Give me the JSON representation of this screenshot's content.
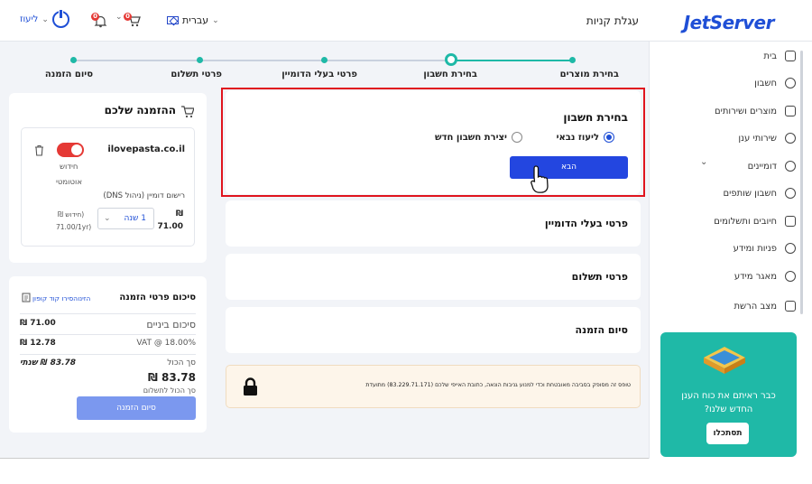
{
  "header": {
    "logo": "JetServer",
    "page_title": "עגלת קניות",
    "language": "עברית",
    "user": "ליעוז",
    "cart_count": "0",
    "notif_count": "0"
  },
  "sidebar": {
    "items": [
      {
        "label": "בית",
        "icon": "home-icon"
      },
      {
        "label": "חשבון",
        "icon": "user-icon"
      },
      {
        "label": "מוצרים ושירותים",
        "icon": "box-icon"
      },
      {
        "label": "שירותי ענן",
        "icon": "cloud-icon"
      },
      {
        "label": "דומיינים",
        "icon": "globe-icon"
      },
      {
        "label": "חשבון שותפים",
        "icon": "users-icon"
      },
      {
        "label": "חיובים ותשלומים",
        "icon": "invoice-icon"
      },
      {
        "label": "פניות ומידע",
        "icon": "headset-icon"
      },
      {
        "label": "מאגר מידע",
        "icon": "bulb-icon"
      },
      {
        "label": "מצב הרשת",
        "icon": "chart-icon"
      }
    ],
    "promo": {
      "line1": "כבר ראיתם את כוח הענן",
      "line2": "החדש שלנו?",
      "button": "תסתכלו"
    }
  },
  "steps": [
    "בחירת מוצרים",
    "בחירת חשבון",
    "פרטי בעלי הדומיין",
    "פרטי תשלום",
    "סיום הזמנה"
  ],
  "account": {
    "title": "בחירת חשבון",
    "option1": "ליעוז נבאי",
    "option2": "יצירת חשבון חדש",
    "next": "הבא"
  },
  "sections": [
    "פרטי בעלי הדומיין",
    "פרטי תשלום",
    "סיום הזמנה"
  ],
  "secure_note": "טופס זה מסופק בסביבה מאובטחת וכדי למנוע גניבות הונאה, כתובת האייפי שלכם (83.229.71.171) מתועדת",
  "order": {
    "title": "ההזמנה שלכם",
    "domain": "ilovepasta.co.il",
    "renew_line1": "חידוש",
    "renew_line2": "אוטומטי",
    "reg_desc": "רישום דומיין (ניהול DNS)",
    "price_symbol": "₪",
    "price": "71.00",
    "period": "1 שנה",
    "renew_label": "(חידוש ₪",
    "renew_price": "(71.00/1yr"
  },
  "summary": {
    "title": "סיכום פרטי הזמנה",
    "coupon": "הזינוהסירו קוד קופון",
    "subtotal_label": "סיכום ביניים",
    "subtotal": "71.00 ₪",
    "vat_label": "VAT @ 18.00%",
    "vat": "12.78 ₪",
    "total_label": "סך הכול",
    "total_yearly": "83.78 ₪ שנתי",
    "total": "83.78 ₪",
    "due_label": "סך הכול לתשלום",
    "finish": "סיום הזמנה"
  }
}
